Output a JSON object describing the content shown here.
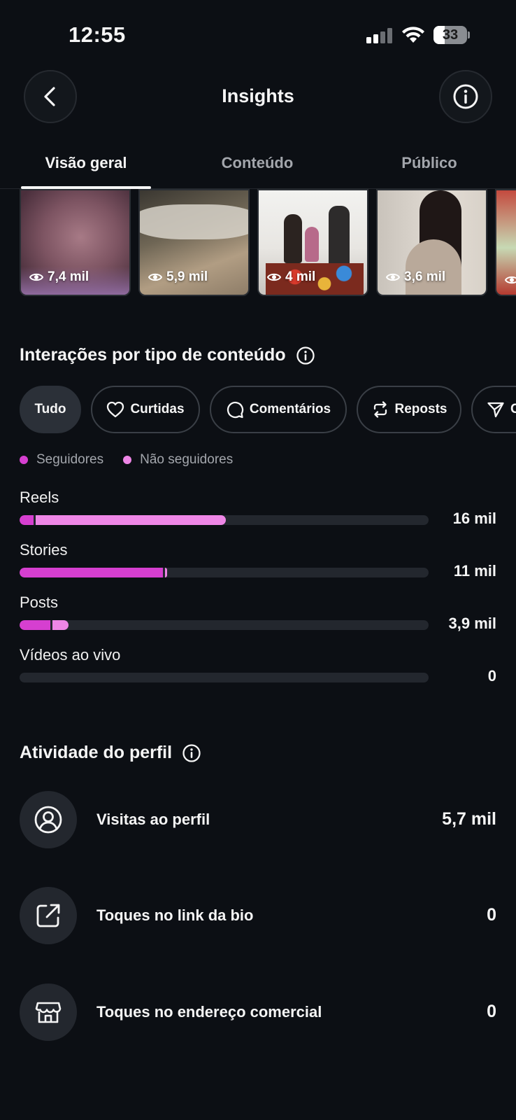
{
  "status_bar": {
    "time": "12:55",
    "battery": "33",
    "battery_level": 0.33
  },
  "header": {
    "title": "Insights",
    "back_icon": "chevron-left-icon",
    "info_icon": "info-icon"
  },
  "tabs": [
    {
      "label": "Visão geral",
      "active": true
    },
    {
      "label": "Conteúdo",
      "active": false
    },
    {
      "label": "Público",
      "active": false
    }
  ],
  "thumbnails": [
    {
      "views": "7,4 mil"
    },
    {
      "views": "5,9 mil"
    },
    {
      "views": "4 mil"
    },
    {
      "views": "3,6 mil"
    },
    {
      "views": ""
    }
  ],
  "interactions": {
    "title": "Interações por tipo de conteúdo",
    "filters": [
      {
        "label": "Tudo",
        "icon": "",
        "active": true
      },
      {
        "label": "Curtidas",
        "icon": "heart-icon",
        "active": false
      },
      {
        "label": "Comentários",
        "icon": "comment-icon",
        "active": false
      },
      {
        "label": "Reposts",
        "icon": "repost-icon",
        "active": false
      },
      {
        "label": "C",
        "icon": "send-icon",
        "active": false
      }
    ],
    "legend": {
      "followers": "Seguidores",
      "non_followers": "Não seguidores"
    },
    "colors": {
      "followers": "#d63fd0",
      "non_followers": "#ee86e6",
      "track": "#23272e"
    },
    "rows": [
      {
        "label": "Reels",
        "value": "16 mil",
        "followers_fraction": 0.034,
        "non_followers_fraction": 0.47
      },
      {
        "label": "Stories",
        "value": "11 mil",
        "followers_fraction": 0.35,
        "non_followers_fraction": 0.006
      },
      {
        "label": "Posts",
        "value": "3,9 mil",
        "followers_fraction": 0.075,
        "non_followers_fraction": 0.045
      },
      {
        "label": "Vídeos ao vivo",
        "value": "0",
        "followers_fraction": 0,
        "non_followers_fraction": 0
      }
    ]
  },
  "profile_activity": {
    "title": "Atividade do perfil",
    "rows": [
      {
        "label": "Visitas ao perfil",
        "value": "5,7 mil",
        "icon": "profile-icon"
      },
      {
        "label": "Toques no link da bio",
        "value": "0",
        "icon": "external-link-icon"
      },
      {
        "label": "Toques no endereço comercial",
        "value": "0",
        "icon": "storefront-icon"
      }
    ]
  }
}
